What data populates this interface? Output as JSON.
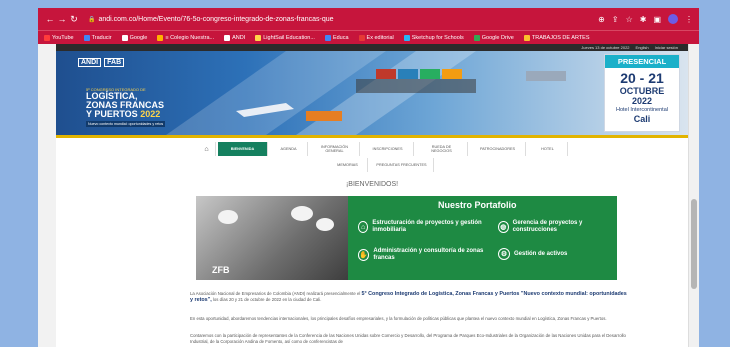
{
  "browser": {
    "url": "andi.com.co/Home/Evento/76-5o-congreso-integrado-de-zonas-francas-que",
    "bookmarks": [
      {
        "label": "YouTube",
        "color": "#ff3b3b"
      },
      {
        "label": "Traducir",
        "color": "#4285f4"
      },
      {
        "label": "Google",
        "color": "#ffffff"
      },
      {
        "label": "≡ Colegio Nuestra...",
        "color": "#ffb300"
      },
      {
        "label": "ANDI",
        "color": "#ffffff"
      },
      {
        "label": "LightSail Education...",
        "color": "#ffd54a"
      },
      {
        "label": "Educa",
        "color": "#4285f4"
      },
      {
        "label": "Ex editorial",
        "color": "#e53935"
      },
      {
        "label": "Sketchup for Schools",
        "color": "#29b6f6"
      },
      {
        "label": "Google Drive",
        "color": "#34a853"
      },
      {
        "label": "TRABAJOS DE ARTES",
        "color": "#fbc02d"
      }
    ]
  },
  "utilbar": {
    "date": "Jueves 13 de octubre 2022",
    "lang": "English",
    "login": "Iniciar sesión"
  },
  "banner": {
    "logo1": "ANDI",
    "logo2": "FAB",
    "pre": "5º CONGRESO INTEGRADO DE",
    "line1": "LOGÍSTICA,",
    "line2": "ZONAS FRANCAS",
    "line3": "Y PUERTOS",
    "year": "2022",
    "subtitle": "Nuevo contexto mundial: oportunidades y retos",
    "presencial": "PRESENCIAL",
    "days": "20 - 21",
    "month": "OCTUBRE",
    "year2": "2022",
    "hotel": "Hotel Intercontinental",
    "city": "Cali"
  },
  "nav": {
    "row1": [
      "BIENVENIDA",
      "AGENDA",
      "INFORMACIÓN GENERAL",
      "INSCRIPCIONES",
      "RUEDA DE NEGOCIOS",
      "PATROCINADORES",
      "HOTEL"
    ],
    "row2": [
      "MEMORIAS",
      "PREGUNTAS FRECUENTES"
    ],
    "active_index": 0
  },
  "welcome": "¡BIENVENIDOS!",
  "portfolio": {
    "brand": "ZFB",
    "title": "Nuestro Portafolio",
    "services": [
      {
        "text": "Estructuración de proyectos y gestión inmobiliaria",
        "icon": "house-icon"
      },
      {
        "text": "Gerencia de proyectos y construcciones",
        "icon": "globe-icon"
      },
      {
        "text": "Administración y consultoría de zonas francas",
        "icon": "handshake-icon"
      },
      {
        "text": "Gestión de activos",
        "icon": "gear-icon"
      }
    ]
  },
  "paragraphs": {
    "p1_pre": "La Asociación Nacional de Empresarios de Colombia (ANDI) realizará presencialmente el",
    "p1_bold": "5° Congreso Integrado de Logística, Zonas Francas y Puertos \"Nuevo contexto mundial: oportunidades y retos\",",
    "p1_post": "los días 20 y 21 de octubre de 2022 en la ciudad de Cali.",
    "p2": "En esta oportunidad, abordaremos tendencias internacionales, los principales desafíos empresariales, y la formulación de políticas públicas que plantea el nuevo contexto mundial en Logística, Zonas Francas y Puertos.",
    "p3": "Contaremos con la participación de representantes de la Conferencia de las Naciones Unidas sobre Comercio y Desarrollo, del Programa de Parques Eco-Industriales de la Organización de las Naciones Unidas para el Desarrollo Industrial, de la Corporación Andina de Fomento, así como de conferencistas de"
  }
}
